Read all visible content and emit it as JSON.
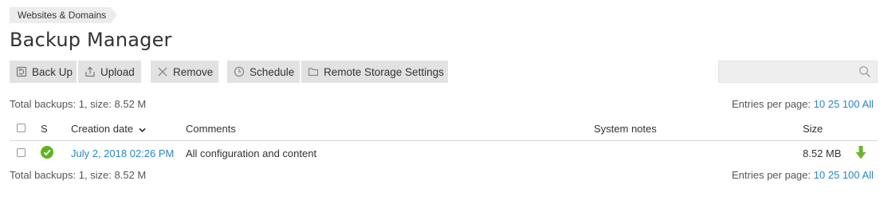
{
  "breadcrumb": {
    "label": "Websites & Domains"
  },
  "page": {
    "title": "Backup Manager"
  },
  "toolbar": {
    "back_up": "Back Up",
    "upload": "Upload",
    "remove": "Remove",
    "schedule": "Schedule",
    "remote_storage": "Remote Storage Settings"
  },
  "summary": {
    "text": "Total backups: 1, size: 8.52 M"
  },
  "pagination": {
    "label": "Entries per page:",
    "options": [
      "10",
      "25",
      "100",
      "All"
    ]
  },
  "table": {
    "columns": {
      "status": "S",
      "creation_date": "Creation date",
      "comments": "Comments",
      "system_notes": "System notes",
      "size": "Size"
    },
    "rows": [
      {
        "creation_date": "July 2, 2018 02:26 PM",
        "comments": "All configuration and content",
        "system_notes": "",
        "size": "8.52 MB",
        "status": "success"
      }
    ]
  },
  "colors": {
    "link": "#2a86c6",
    "success": "#5fb31f",
    "download": "#6bb52a",
    "button_bg": "#e2e2e2"
  },
  "icons": {
    "back_up": "backup-icon",
    "upload": "upload-icon",
    "remove": "remove-icon",
    "schedule": "clock-icon",
    "remote_storage": "folder-icon",
    "search": "search-icon",
    "status": "check-circle-icon",
    "download": "download-arrow-icon",
    "sort": "chevron-down-icon"
  }
}
